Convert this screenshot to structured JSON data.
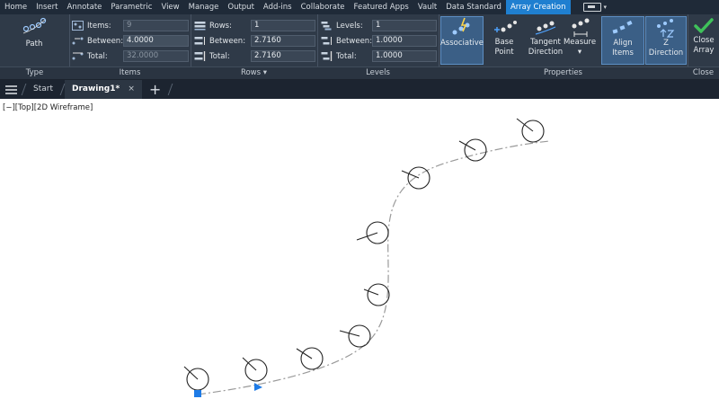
{
  "menu_tabs": [
    "Home",
    "Insert",
    "Annotate",
    "Parametric",
    "View",
    "Manage",
    "Output",
    "Add-ins",
    "Collaborate",
    "Featured Apps",
    "Vault",
    "Data Standard",
    "Array Creation"
  ],
  "active_menu_tab": "Array Creation",
  "ribbon": {
    "type_panel": {
      "button": "Path",
      "title": "Type"
    },
    "items_panel": {
      "title": "Items",
      "items_label": "Items:",
      "items_value": "9",
      "between_label": "Between:",
      "between_value": "4.0000",
      "total_label": "Total:",
      "total_value": "32.0000"
    },
    "rows_panel": {
      "title": "Rows ▾",
      "rows_label": "Rows:",
      "rows_value": "1",
      "between_label": "Between:",
      "between_value": "2.7160",
      "total_label": "Total:",
      "total_value": "2.7160"
    },
    "levels_panel": {
      "title": "Levels",
      "levels_label": "Levels:",
      "levels_value": "1",
      "between_label": "Between:",
      "between_value": "1.0000",
      "total_label": "Total:",
      "total_value": "1.0000"
    },
    "properties_panel": {
      "title": "Properties",
      "associative": "Associative",
      "base_point": "Base Point",
      "tangent_direction_1": "Tangent",
      "tangent_direction_2": "Direction",
      "measure": "Measure",
      "align_items": "Align Items",
      "z_direction": "Z Direction"
    },
    "close_panel": {
      "close_1": "Close",
      "close_2": "Array",
      "title": "Close"
    }
  },
  "doc_tabs": {
    "start": "Start",
    "drawing": "Drawing1*",
    "close": "×",
    "add": "+"
  },
  "viewport_label": "[−][Top][2D Wireframe]",
  "colors": {
    "accent": "#1f7fd0",
    "grip": "#1e7be6"
  }
}
